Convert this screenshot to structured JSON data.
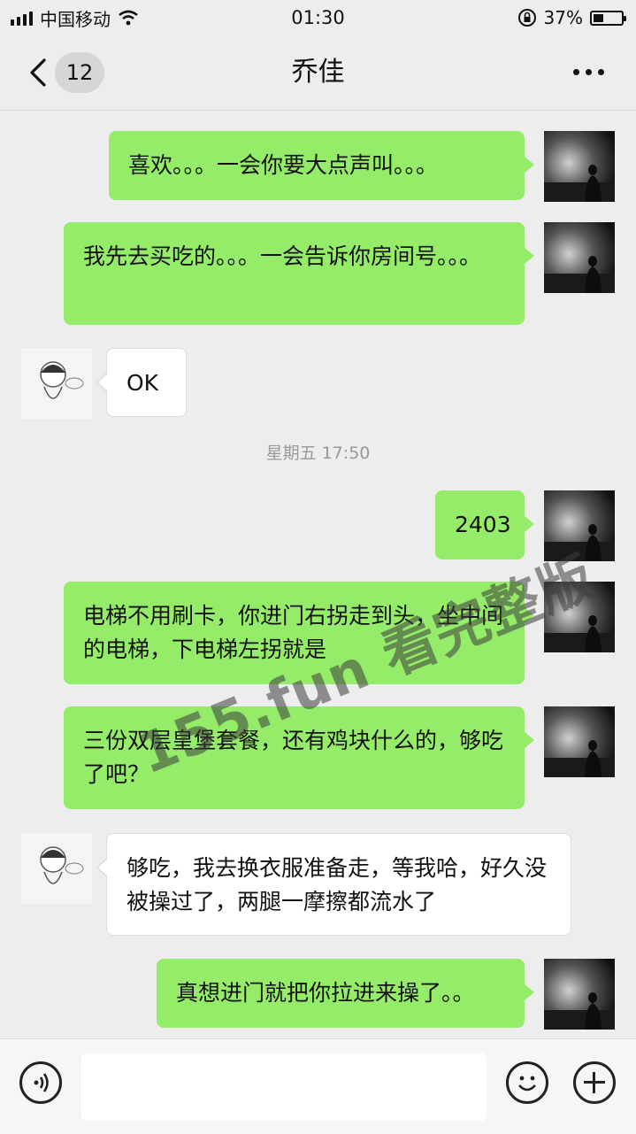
{
  "status_bar": {
    "carrier": "中国移动",
    "time": "01:30",
    "battery_percent_label": "37%",
    "battery_level": 0.37
  },
  "header": {
    "back_icon": "chevron-left-icon",
    "unread_count": "12",
    "title": "乔佳",
    "more_icon": "more-dots-icon"
  },
  "messages": [
    {
      "from": "me",
      "text": "喜欢。。。一会你要大点声叫。。。"
    },
    {
      "from": "me",
      "text": "我先去买吃的。。。一会告诉你房间号。。。"
    },
    {
      "from": "her",
      "text": "OK"
    },
    {
      "type": "timestamp",
      "text": "星期五 17:50"
    },
    {
      "from": "me",
      "text": "2403"
    },
    {
      "from": "me",
      "text": "电梯不用刷卡，你进门右拐走到头，坐中间的电梯，下电梯左拐就是"
    },
    {
      "from": "me",
      "text": "三份双层皇堡套餐，还有鸡块什么的，够吃了吧？"
    },
    {
      "from": "her",
      "text": "够吃，我去换衣服准备走，等我哈，好久没被操过了，两腿一摩擦都流水了"
    },
    {
      "from": "me",
      "text": "真想进门就把你拉进来操了。。"
    }
  ],
  "watermark": "155.fun 看完整版",
  "input_bar": {
    "voice_icon": "voice-icon",
    "text_value": "",
    "emoji_icon": "emoji-icon",
    "plus_icon": "plus-icon"
  },
  "colors": {
    "my_bubble": "#95ec69",
    "her_bubble": "#ffffff",
    "background": "#ededed"
  }
}
